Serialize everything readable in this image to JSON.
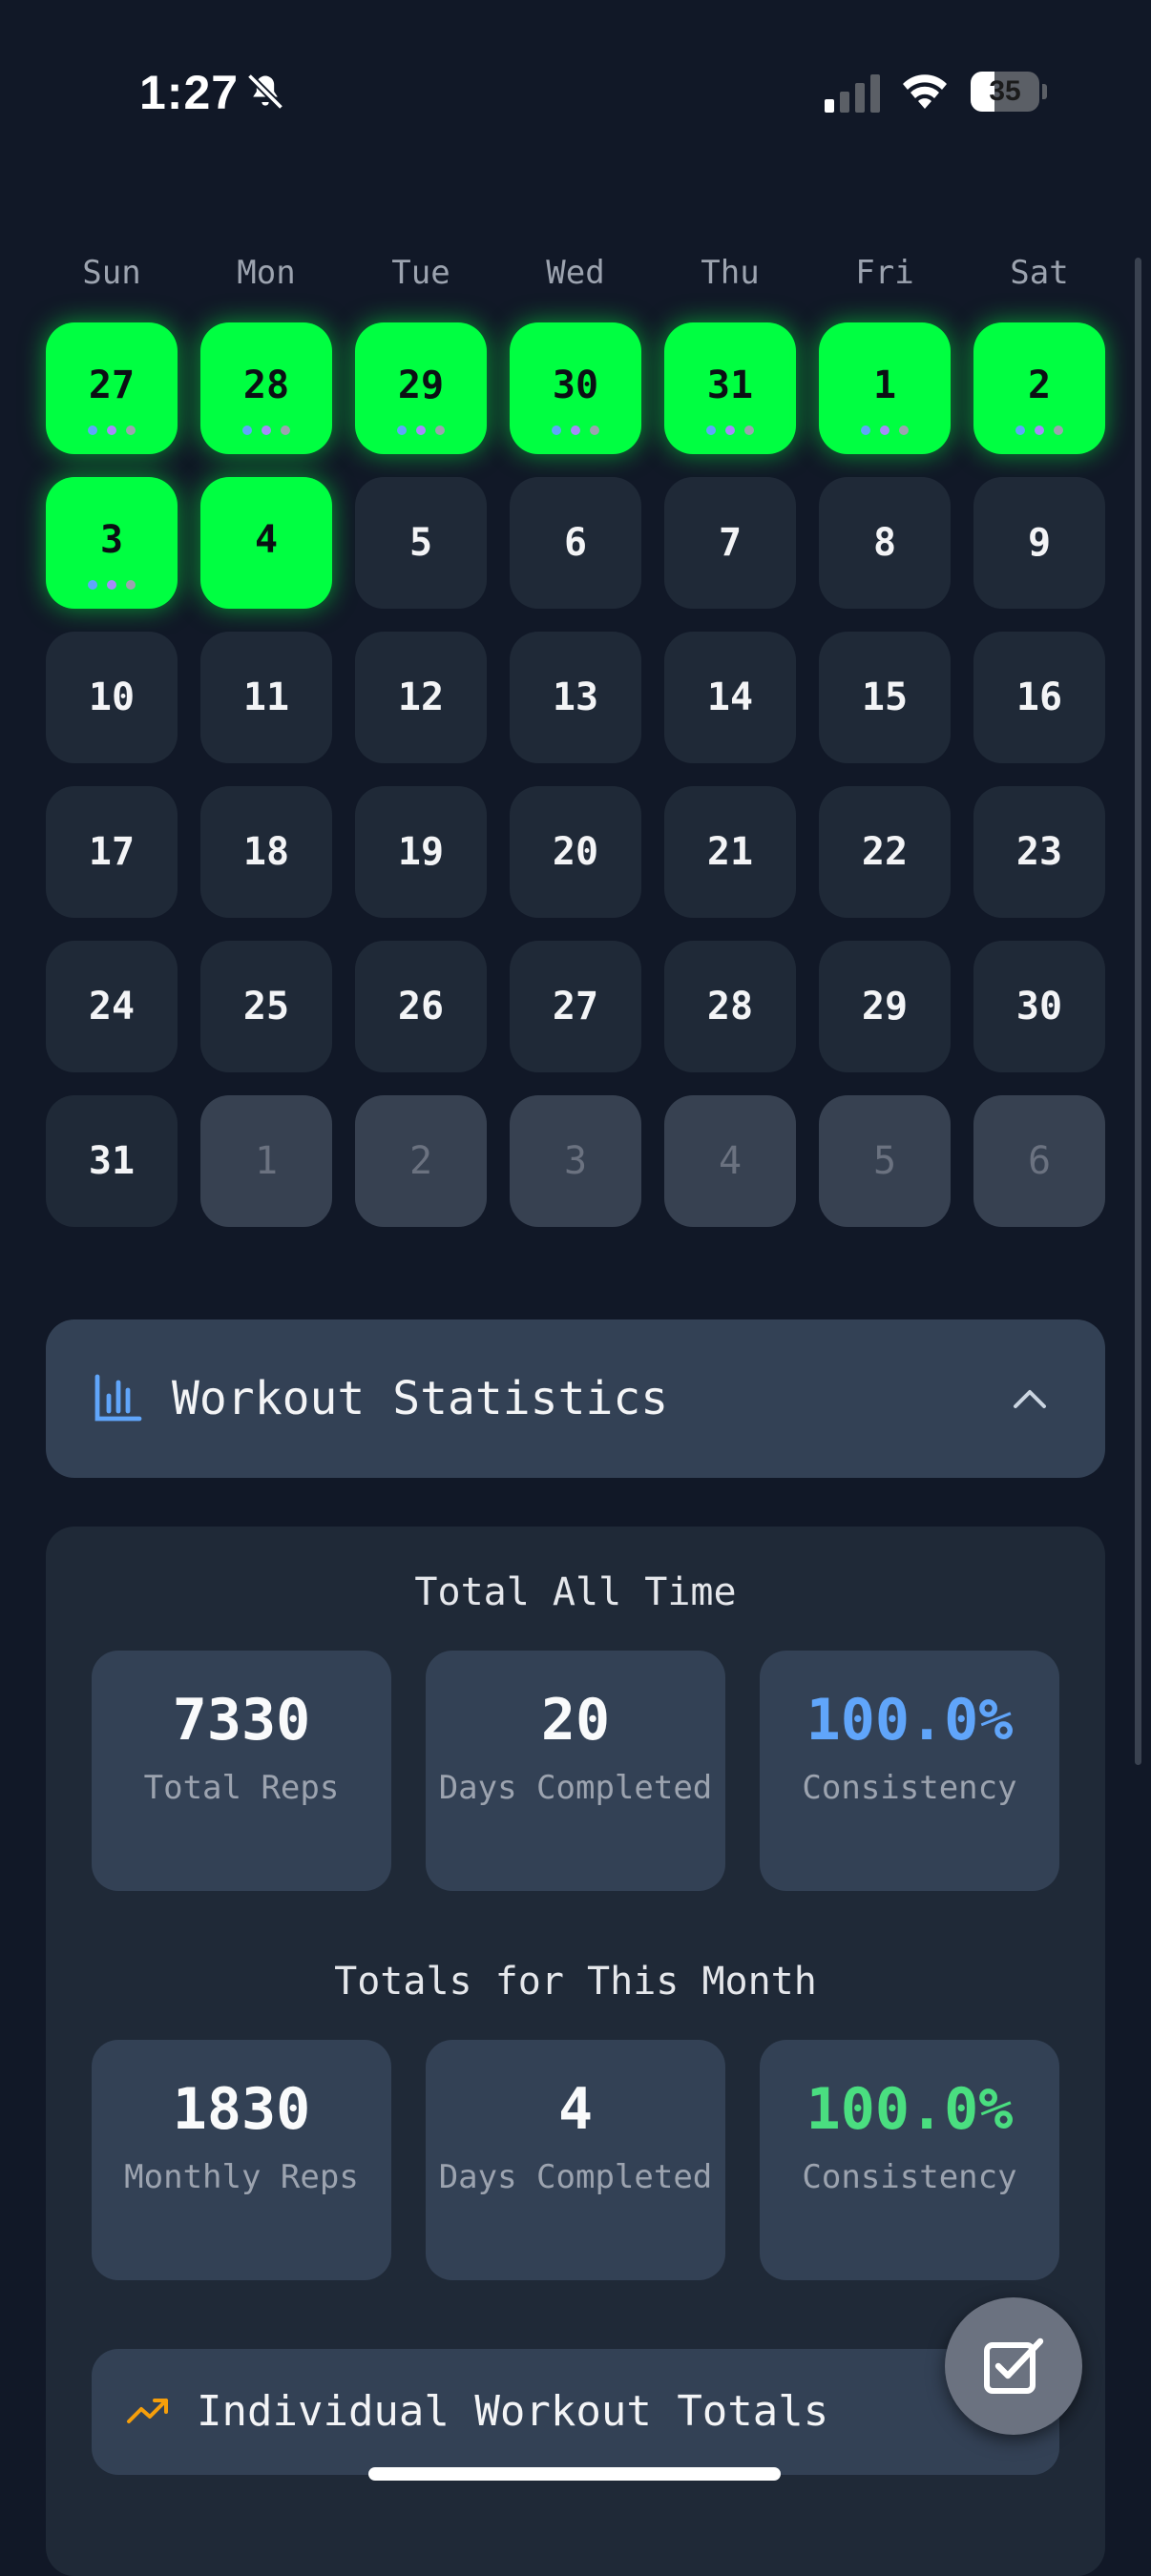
{
  "status_bar": {
    "time": "1:27",
    "battery": "35",
    "battery_level": 0.35,
    "icons": [
      "bell-slash-icon",
      "cellular-signal-icon",
      "wifi-icon",
      "battery-icon"
    ]
  },
  "calendar": {
    "weekdays": [
      "Sun",
      "Mon",
      "Tue",
      "Wed",
      "Thu",
      "Fri",
      "Sat"
    ],
    "weeks": [
      [
        {
          "day": "27",
          "state": "completed",
          "dots": 3
        },
        {
          "day": "28",
          "state": "completed",
          "dots": 3
        },
        {
          "day": "29",
          "state": "completed",
          "dots": 3
        },
        {
          "day": "30",
          "state": "completed",
          "dots": 3
        },
        {
          "day": "31",
          "state": "completed",
          "dots": 3
        },
        {
          "day": "1",
          "state": "completed",
          "dots": 3
        },
        {
          "day": "2",
          "state": "completed",
          "dots": 3
        }
      ],
      [
        {
          "day": "3",
          "state": "completed",
          "dots": 3
        },
        {
          "day": "4",
          "state": "completed",
          "dots": 0
        },
        {
          "day": "5",
          "state": "normal",
          "dots": 0
        },
        {
          "day": "6",
          "state": "normal",
          "dots": 0
        },
        {
          "day": "7",
          "state": "normal",
          "dots": 0
        },
        {
          "day": "8",
          "state": "normal",
          "dots": 0
        },
        {
          "day": "9",
          "state": "normal",
          "dots": 0
        }
      ],
      [
        {
          "day": "10",
          "state": "normal",
          "dots": 0
        },
        {
          "day": "11",
          "state": "normal",
          "dots": 0
        },
        {
          "day": "12",
          "state": "normal",
          "dots": 0
        },
        {
          "day": "13",
          "state": "normal",
          "dots": 0
        },
        {
          "day": "14",
          "state": "normal",
          "dots": 0
        },
        {
          "day": "15",
          "state": "normal",
          "dots": 0
        },
        {
          "day": "16",
          "state": "normal",
          "dots": 0
        }
      ],
      [
        {
          "day": "17",
          "state": "normal",
          "dots": 0
        },
        {
          "day": "18",
          "state": "normal",
          "dots": 0
        },
        {
          "day": "19",
          "state": "normal",
          "dots": 0
        },
        {
          "day": "20",
          "state": "normal",
          "dots": 0
        },
        {
          "day": "21",
          "state": "normal",
          "dots": 0
        },
        {
          "day": "22",
          "state": "normal",
          "dots": 0
        },
        {
          "day": "23",
          "state": "normal",
          "dots": 0
        }
      ],
      [
        {
          "day": "24",
          "state": "normal",
          "dots": 0
        },
        {
          "day": "25",
          "state": "normal",
          "dots": 0
        },
        {
          "day": "26",
          "state": "normal",
          "dots": 0
        },
        {
          "day": "27",
          "state": "normal",
          "dots": 0
        },
        {
          "day": "28",
          "state": "normal",
          "dots": 0
        },
        {
          "day": "29",
          "state": "normal",
          "dots": 0
        },
        {
          "day": "30",
          "state": "normal",
          "dots": 0
        }
      ],
      [
        {
          "day": "31",
          "state": "normal",
          "dots": 0
        },
        {
          "day": "1",
          "state": "other_month",
          "dots": 0
        },
        {
          "day": "2",
          "state": "other_month",
          "dots": 0
        },
        {
          "day": "3",
          "state": "other_month",
          "dots": 0
        },
        {
          "day": "4",
          "state": "other_month",
          "dots": 0
        },
        {
          "day": "5",
          "state": "other_month",
          "dots": 0
        },
        {
          "day": "6",
          "state": "other_month",
          "dots": 0
        }
      ]
    ],
    "dot_colors": [
      "#60a5fa",
      "#a78bfa",
      "#9ca3af"
    ]
  },
  "stats": {
    "header_title": "Workout Statistics",
    "header_icon": "bar-chart-icon",
    "collapse_icon": "chevron-up-icon",
    "all_time": {
      "title": "Total All Time",
      "cards": [
        {
          "value": "7330",
          "label": "Total Reps",
          "color": "#f9fafb"
        },
        {
          "value": "20",
          "label": "Days Completed",
          "color": "#f9fafb"
        },
        {
          "value": "100.0%",
          "label": "Consistency",
          "color": "#60a5fa"
        }
      ]
    },
    "month": {
      "title": "Totals for This Month",
      "cards": [
        {
          "value": "1830",
          "label": "Monthly Reps",
          "color": "#f9fafb"
        },
        {
          "value": "4",
          "label": "Days Completed",
          "color": "#f9fafb"
        },
        {
          "value": "100.0%",
          "label": "Consistency",
          "color": "#4ade80"
        }
      ]
    },
    "individual_totals_label": "Individual Workout Totals",
    "individual_icon": "trending-up-icon"
  },
  "fab": {
    "icon": "checkbox-edit-icon"
  },
  "colors": {
    "background": "#111827",
    "completed": "#00ff41",
    "card": "#334155",
    "panel": "#1f2937",
    "accent_blue": "#60a5fa",
    "accent_green": "#4ade80",
    "accent_orange": "#f59e0b"
  }
}
